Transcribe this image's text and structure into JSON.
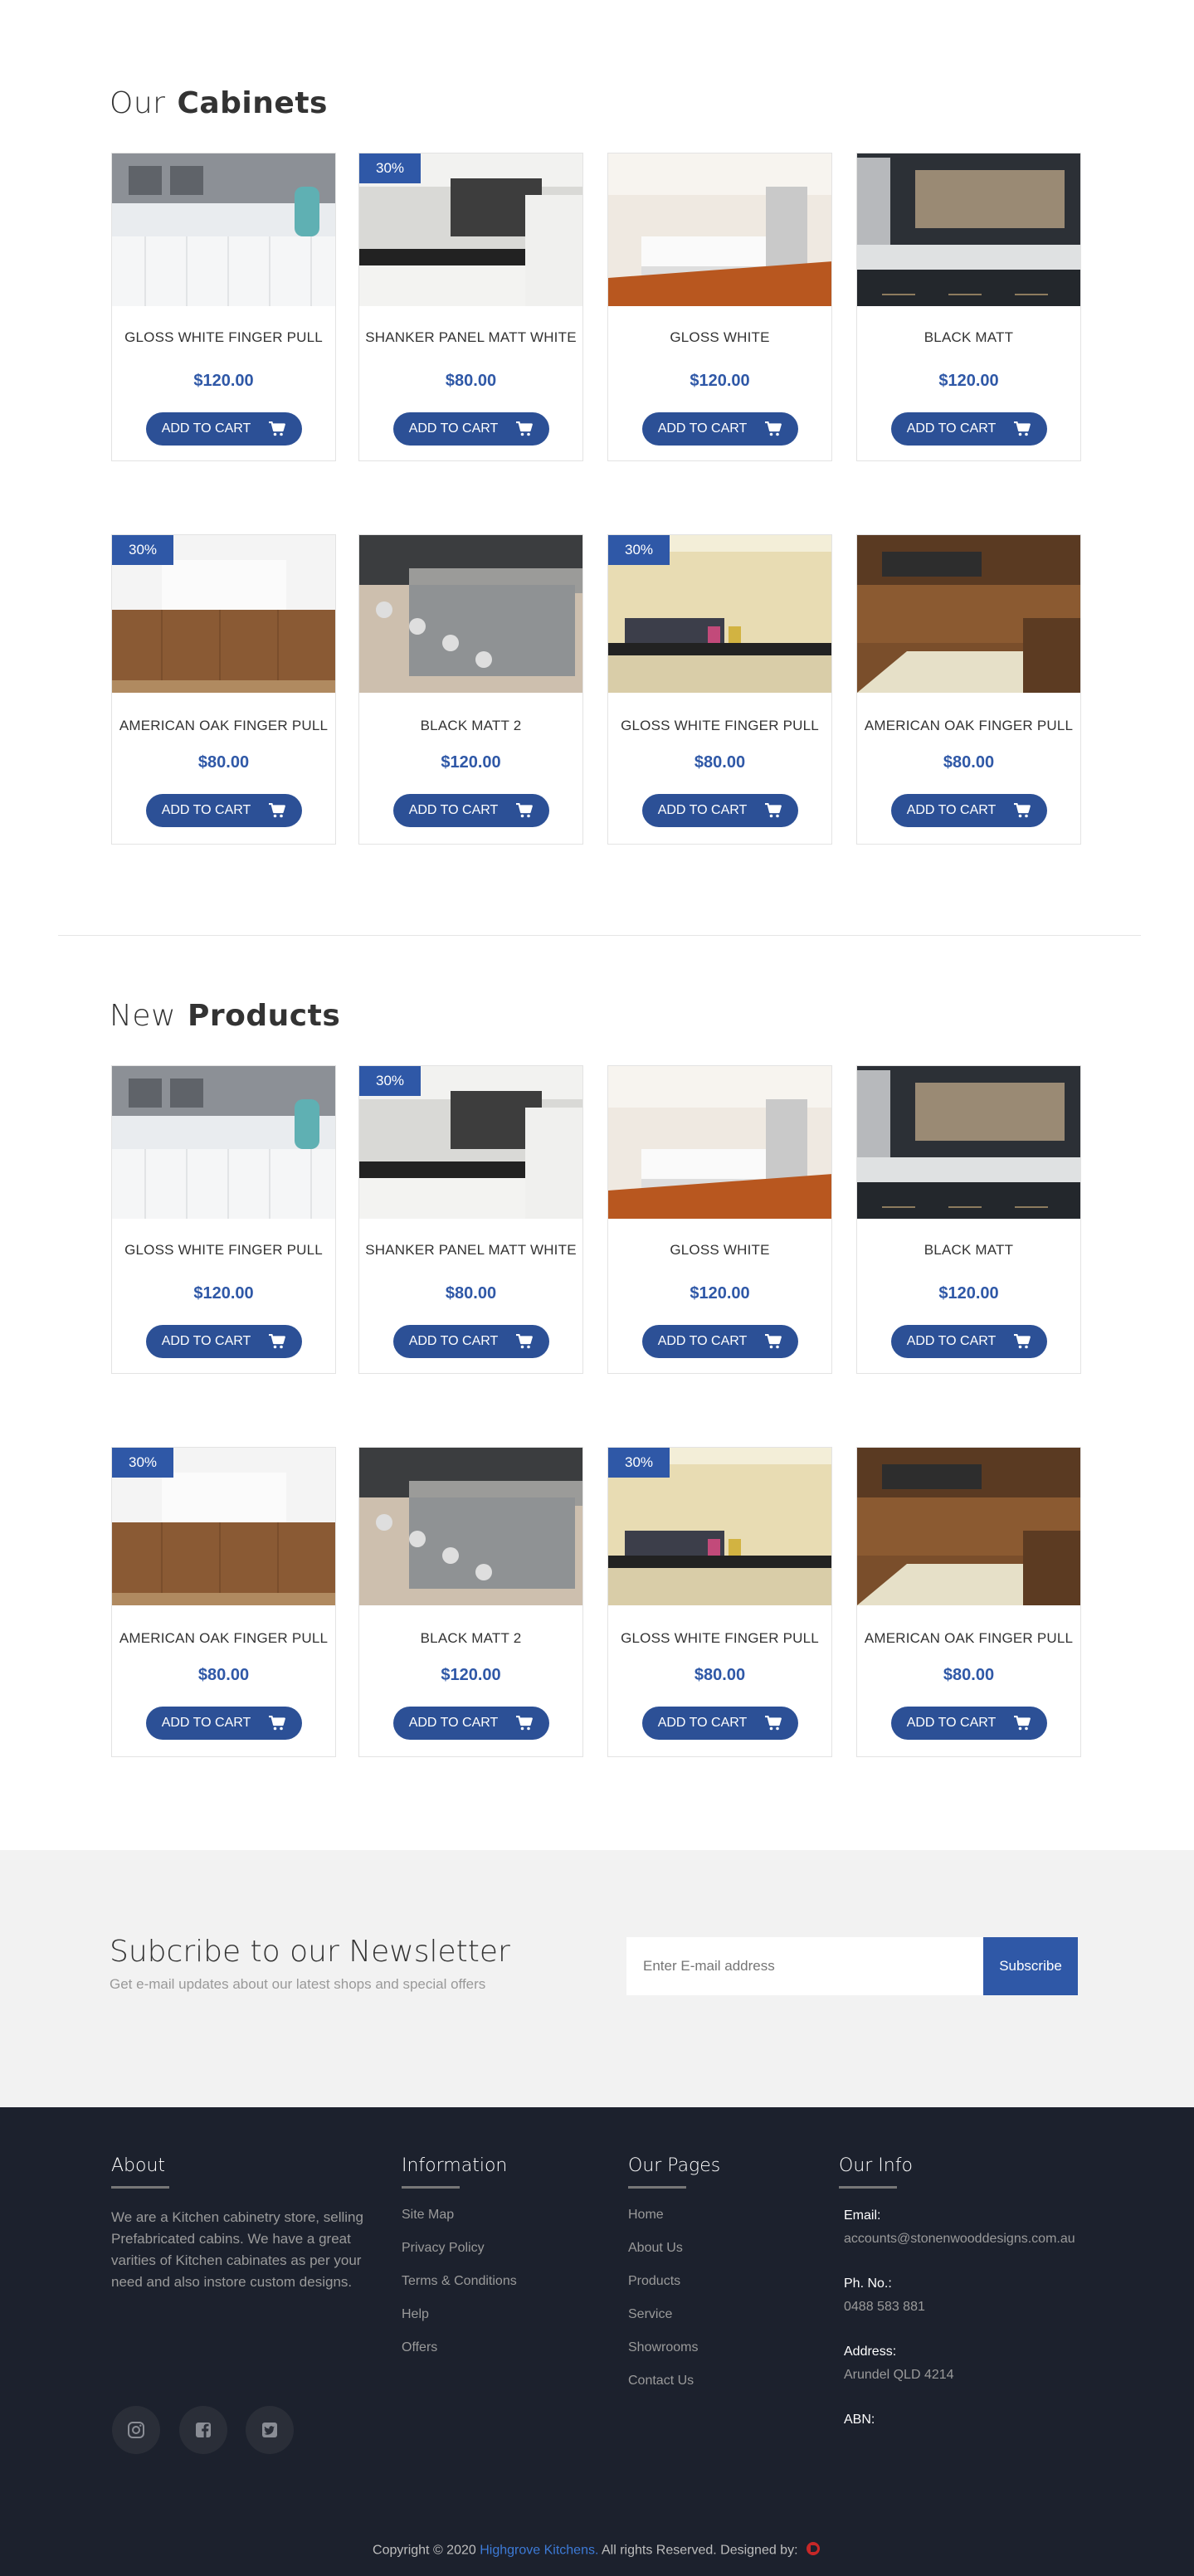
{
  "sections": [
    {
      "title_light": "Our",
      "title_bold": "Cabinets",
      "rows": [
        [
          {
            "name": "GLOSS WHITE FINGER PULL",
            "price": "$120.00",
            "badge": "",
            "cta": "ADD TO CART"
          },
          {
            "name": "SHANKER PANEL MATT WHITE",
            "price": "$80.00",
            "badge": "30%",
            "cta": "ADD TO CART"
          },
          {
            "name": "GLOSS WHITE",
            "price": "$120.00",
            "badge": "",
            "cta": "ADD TO CART"
          },
          {
            "name": "BLACK MATT",
            "price": "$120.00",
            "badge": "",
            "cta": "ADD TO CART"
          }
        ],
        [
          {
            "name": "AMERICAN OAK FINGER PULL",
            "price": "$80.00",
            "badge": "30%",
            "cta": "ADD TO CART"
          },
          {
            "name": "BLACK MATT 2",
            "price": "$120.00",
            "badge": "",
            "cta": "ADD TO CART"
          },
          {
            "name": "GLOSS WHITE FINGER PULL",
            "price": "$80.00",
            "badge": "30%",
            "cta": "ADD TO CART"
          },
          {
            "name": "AMERICAN OAK FINGER PULL",
            "price": "$80.00",
            "badge": "",
            "cta": "ADD TO CART"
          }
        ]
      ]
    },
    {
      "title_light": "New",
      "title_bold": "Products",
      "rows": [
        [
          {
            "name": "GLOSS WHITE FINGER PULL",
            "price": "$120.00",
            "badge": "",
            "cta": "ADD TO CART"
          },
          {
            "name": "SHANKER PANEL MATT WHITE",
            "price": "$80.00",
            "badge": "30%",
            "cta": "ADD TO CART"
          },
          {
            "name": "GLOSS WHITE",
            "price": "$120.00",
            "badge": "",
            "cta": "ADD TO CART"
          },
          {
            "name": "BLACK MATT",
            "price": "$120.00",
            "badge": "",
            "cta": "ADD TO CART"
          }
        ],
        [
          {
            "name": "AMERICAN OAK FINGER PULL",
            "price": "$80.00",
            "badge": "30%",
            "cta": "ADD TO CART"
          },
          {
            "name": "BLACK MATT 2",
            "price": "$120.00",
            "badge": "",
            "cta": "ADD TO CART"
          },
          {
            "name": "GLOSS WHITE FINGER PULL",
            "price": "$80.00",
            "badge": "30%",
            "cta": "ADD TO CART"
          },
          {
            "name": "AMERICAN OAK FINGER PULL",
            "price": "$80.00",
            "badge": "",
            "cta": "ADD TO CART"
          }
        ]
      ]
    }
  ],
  "newsletter": {
    "title": "Subcribe to our Newsletter",
    "subtitle": "Get e-mail updates about our latest shops and special offers",
    "placeholder": "Enter E-mail address",
    "button": "Subscribe"
  },
  "footer": {
    "about": {
      "heading": "About",
      "text": "We are a Kitchen cabinetry store, selling Prefabricated cabins. We have a great varities of Kitchen cabinates as per your need and also instore custom designs."
    },
    "information": {
      "heading": "Information",
      "links": [
        "Site Map",
        "Privacy Policy",
        "Terms & Conditions",
        "Help",
        "Offers"
      ]
    },
    "pages": {
      "heading": "Our Pages",
      "links": [
        "Home",
        "About Us",
        "Products",
        "Service",
        "Showrooms",
        "Contact Us"
      ]
    },
    "info": {
      "heading": "Our Info",
      "email_label": "Email:",
      "email": "accounts@stonenwooddesigns.com.au",
      "phone_label": "Ph. No.:",
      "phone": "0488 583 881",
      "address_label": "Address:",
      "address": "Arundel QLD 4214",
      "abn_label": "ABN:"
    },
    "social": [
      "instagram-icon",
      "facebook-icon",
      "twitter-icon"
    ],
    "copyright_prefix": "Copyright © 2020",
    "copyright_brand": "Highgrove Kitchens.",
    "copyright_suffix": "All rights Reserved. Designed by:"
  },
  "colors": {
    "accent": "#2f58a7",
    "button": "#2c5096",
    "footer_bg": "#1c212d",
    "newsletter_bg": "#f2f2f2"
  }
}
